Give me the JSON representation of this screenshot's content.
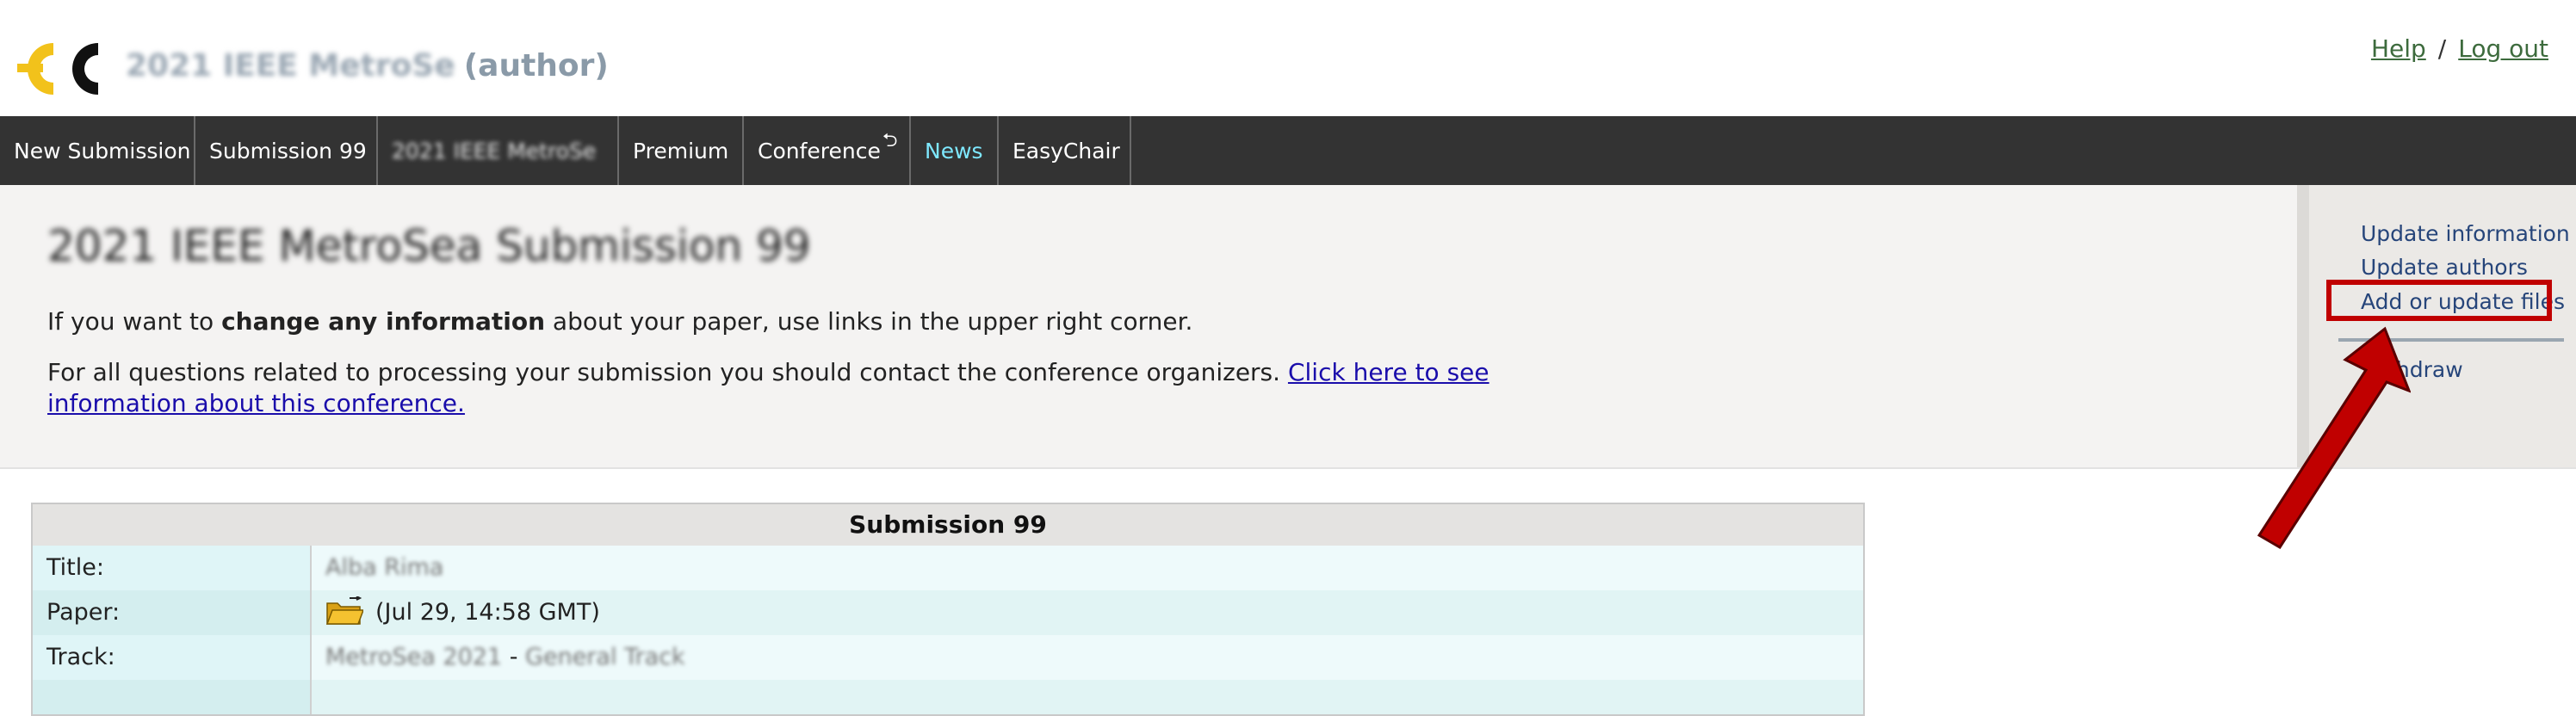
{
  "header": {
    "app_title_blurred": "2021 IEEE MetroSe",
    "app_title_role": "(author)",
    "help_link": "Help",
    "separator": "/",
    "logout_link": "Log out"
  },
  "menu": {
    "items": [
      {
        "label": "New Submission"
      },
      {
        "label": "Submission 99"
      },
      {
        "label": "2021 IEEE MetroSe"
      },
      {
        "label": "Premium"
      },
      {
        "label": "Conference"
      },
      {
        "label": "News"
      },
      {
        "label": "EasyChair"
      }
    ]
  },
  "main": {
    "title_blurred": "2021 IEEE MetroSea Submission 99",
    "line1_prefix": "If you want to ",
    "line1_bold": "change any information",
    "line1_suffix": " about your paper, use links in the upper right corner.",
    "line2_text": "For all questions related to processing your submission you should contact the conference organizers. ",
    "line2_link": "Click here to see information about this conference."
  },
  "side": {
    "update_information": "Update information",
    "update_authors": "Update authors",
    "add_update_files": "Add or update files",
    "withdraw": "Withdraw"
  },
  "colors": {
    "highlight": "#c00000",
    "arrow": "#c00000",
    "menubar": "#333333"
  },
  "table": {
    "header": "Submission 99",
    "rows": [
      {
        "key": "Title:",
        "value": "Alba Rima"
      },
      {
        "key": "Paper:",
        "value": "(Jul 29, 14:58 GMT)",
        "icon": "folder-icon"
      },
      {
        "key": "Track:",
        "value_blur1": "MetroSea 2021",
        "value_mid": " - ",
        "value_blur2": "General Track"
      }
    ]
  }
}
